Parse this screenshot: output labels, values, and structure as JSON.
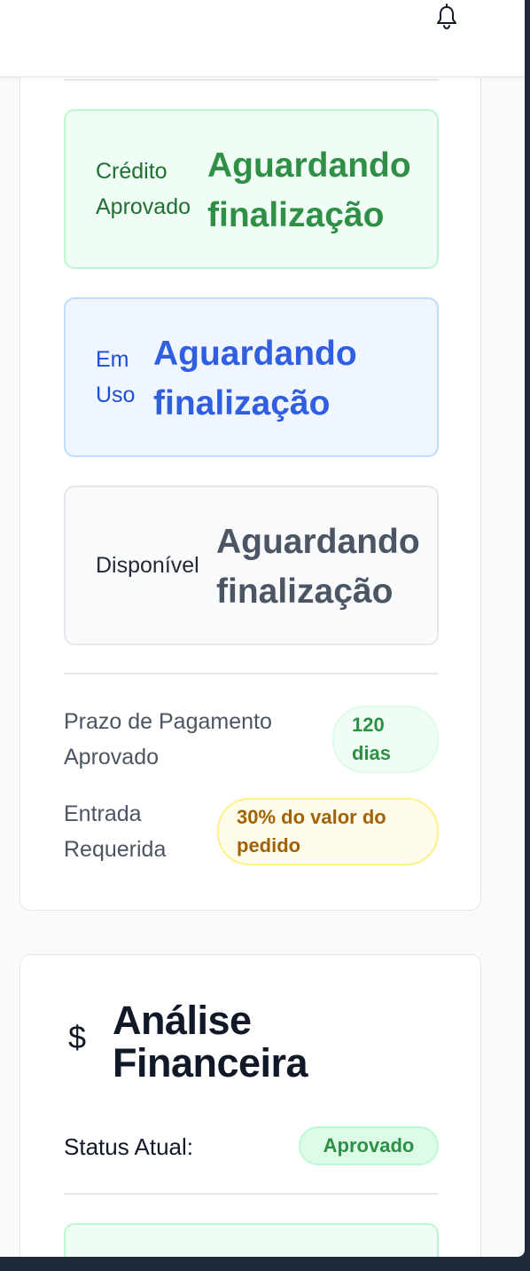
{
  "header": {
    "notification_icon": "bell-icon"
  },
  "credit_summary": {
    "boxes": [
      {
        "label_line1": "Crédito",
        "label_line2": "Aprovado",
        "value_line1": "Aguardando",
        "value_line2": "finalização",
        "color": "#2f8f46"
      },
      {
        "label_line1": "Em",
        "label_line2": "Uso",
        "value_line1": "Aguardando",
        "value_line2": "finalização",
        "color": "#2f5ee0"
      },
      {
        "label_line1": "Disponível",
        "value_line1": "Aguardando",
        "value_line2": "finalização",
        "color": "#4b5563"
      }
    ],
    "terms": [
      {
        "label_line1": "Prazo de Pagamento",
        "label_line2": "Aprovado",
        "value_line1": "120",
        "value_line2": "dias"
      },
      {
        "label_line1": "Entrada",
        "label_line2": "Requerida",
        "value_line1": "30% do valor do",
        "value_line2": "pedido"
      }
    ]
  },
  "financial_analysis": {
    "icon": "dollar-icon",
    "icon_glyph": "$",
    "title_line1": "Análise",
    "title_line2": "Financeira",
    "status_label": "Status Atual:",
    "status_value": "Aprovado"
  },
  "colors": {
    "success": "#2f8f46",
    "info": "#2f5ee0",
    "warning": "#a16207"
  }
}
